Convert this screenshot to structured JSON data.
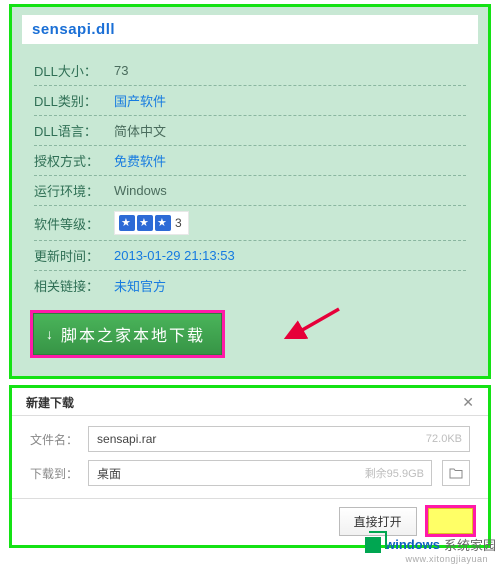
{
  "title": "sensapi.dll",
  "fields": [
    {
      "label": "DLL大小：",
      "value": "73",
      "link": false
    },
    {
      "label": "DLL类别：",
      "value": "国产软件",
      "link": true
    },
    {
      "label": "DLL语言：",
      "value": "简体中文",
      "link": false
    },
    {
      "label": "授权方式：",
      "value": "免费软件",
      "link": true
    },
    {
      "label": "运行环境：",
      "value": "Windows",
      "link": false
    },
    {
      "label": "软件等级：",
      "value_type": "stars",
      "stars": 3,
      "count": "3"
    },
    {
      "label": "更新时间：",
      "value": "2013-01-29 21:13:53",
      "link": true
    },
    {
      "label": "相关链接：",
      "value": "未知官方",
      "link": true
    }
  ],
  "download_btn": "脚本之家本地下载",
  "dialog": {
    "title": "新建下载",
    "filename_label": "文件名：",
    "filename_value": "sensapi.rar",
    "filesize": "72.0KB",
    "dest_label": "下载到：",
    "dest_value": "桌面",
    "dest_remain": "剩余95.9GB",
    "open_btn": "直接打开"
  },
  "watermark": {
    "brand_a": "windows",
    "brand_b": "系统家园",
    "sub": "www.xitongjiayuan"
  }
}
